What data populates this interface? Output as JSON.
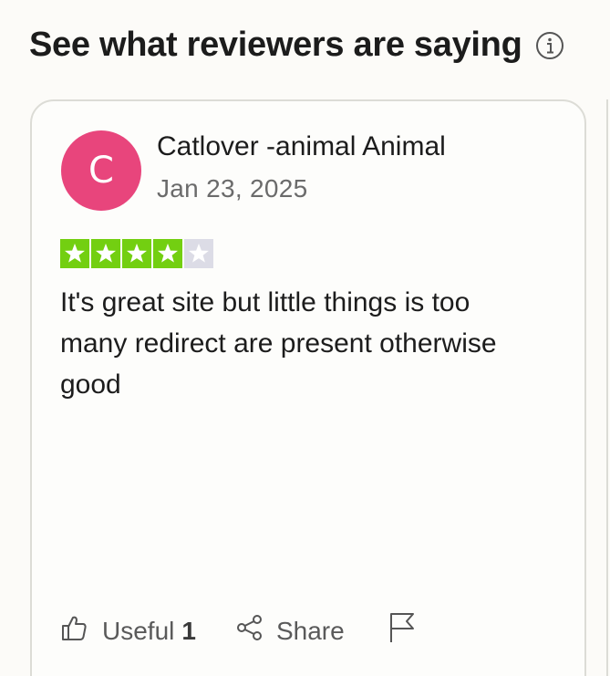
{
  "section": {
    "heading": "See what reviewers are saying",
    "info_icon": "info-circle-icon"
  },
  "review": {
    "avatar_letter": "C",
    "avatar_color": "#e8457c",
    "reviewer_name": "Catlover -animal Animal",
    "date": "Jan 23, 2025",
    "rating": 4,
    "rating_max": 5,
    "star_color_on": "#73cf11",
    "star_color_off": "#dcdce6",
    "text": "It's great site but little things is too many redirect are present otherwise good",
    "actions": {
      "useful_label": "Useful",
      "useful_count": "1",
      "useful_icon": "thumbs-up-icon",
      "share_label": "Share",
      "share_icon": "share-icon",
      "report_icon": "flag-icon"
    }
  }
}
